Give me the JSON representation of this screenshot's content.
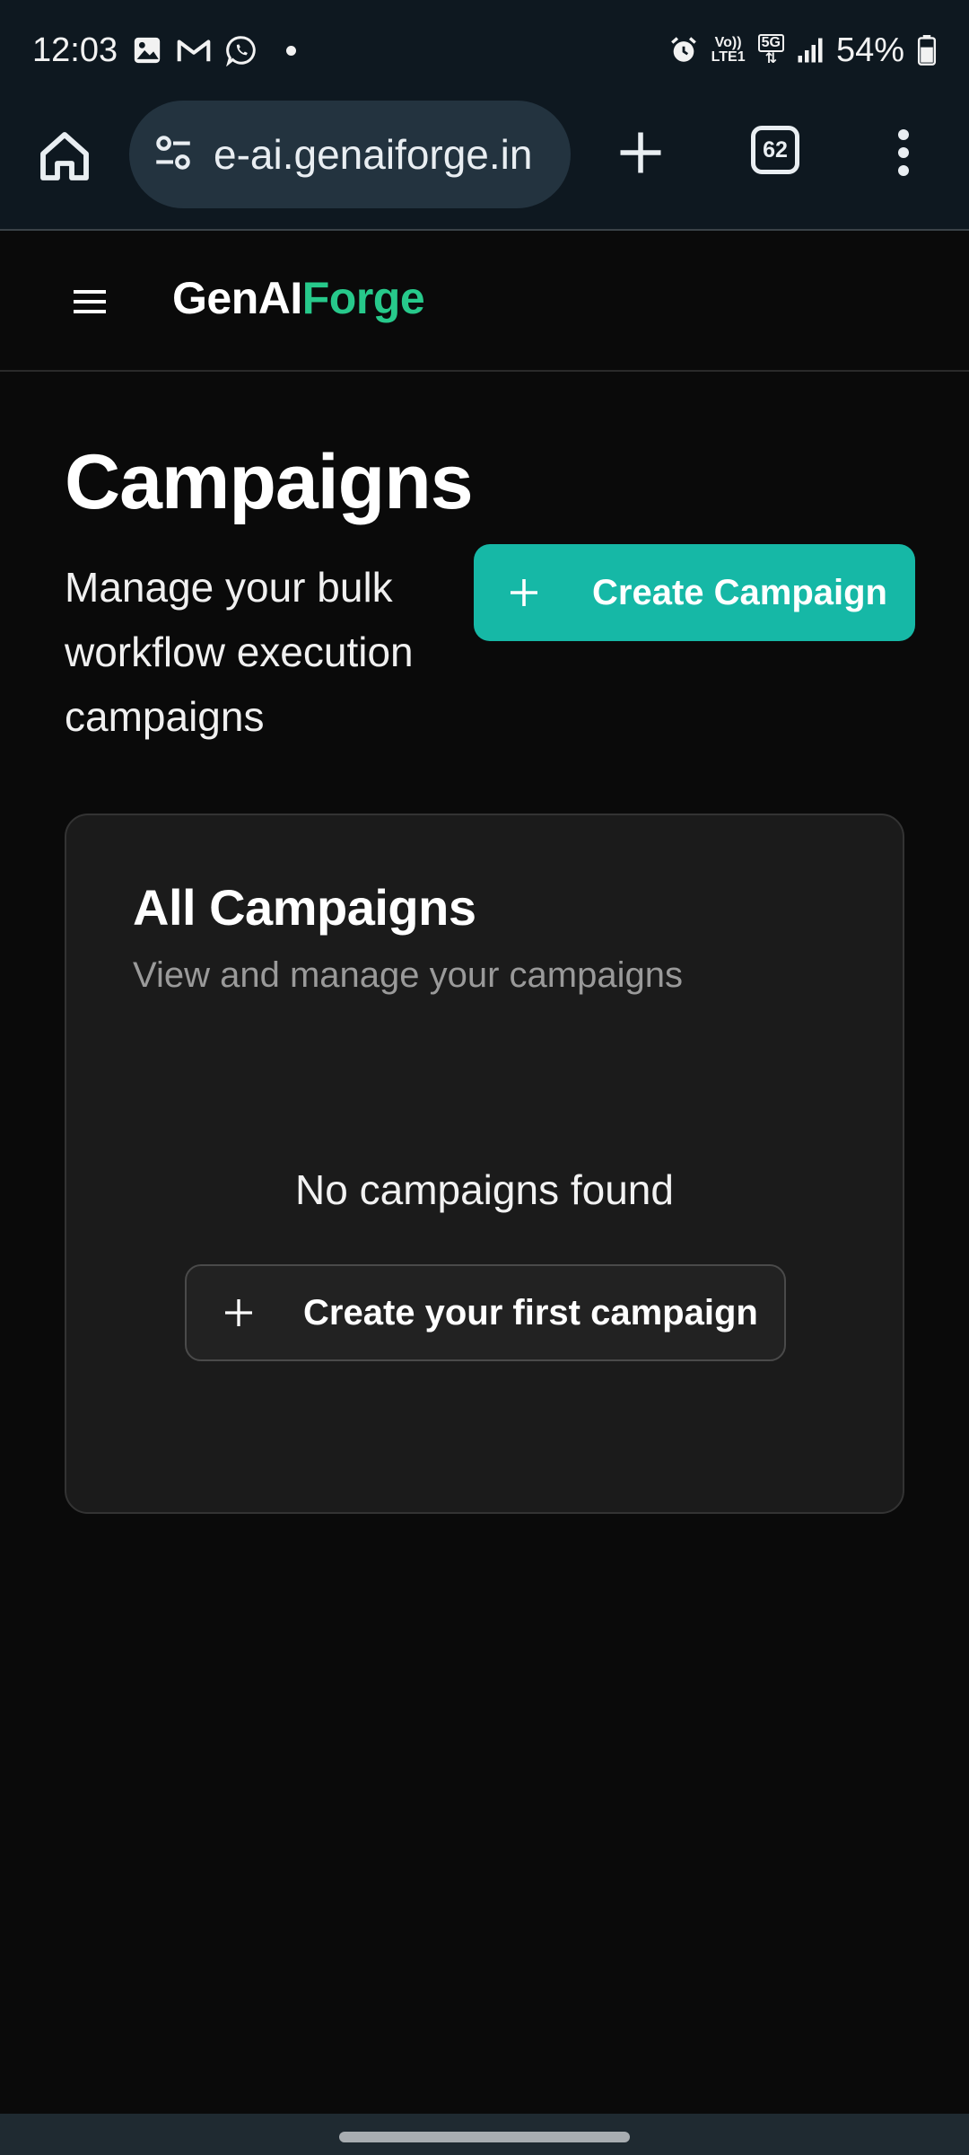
{
  "status_bar": {
    "time": "12:03",
    "network_top": "Vo))",
    "network_bottom": "LTE1",
    "network_type": "5G",
    "battery": "54%"
  },
  "browser": {
    "url": "e-ai.genaiforge.in",
    "tab_count": "62"
  },
  "app": {
    "brand_prefix": "GenAI",
    "brand_accent": "Forge",
    "brand_accent_color": "#27c98b"
  },
  "page": {
    "title": "Campaigns",
    "subtitle": "Manage your bulk workflow execution campaigns",
    "create_button_label": "Create Campaign",
    "primary_color": "#16b8a6"
  },
  "card": {
    "title": "All Campaigns",
    "description": "View and manage your campaigns",
    "empty_message": "No campaigns found",
    "empty_button_label": "Create your first campaign"
  }
}
